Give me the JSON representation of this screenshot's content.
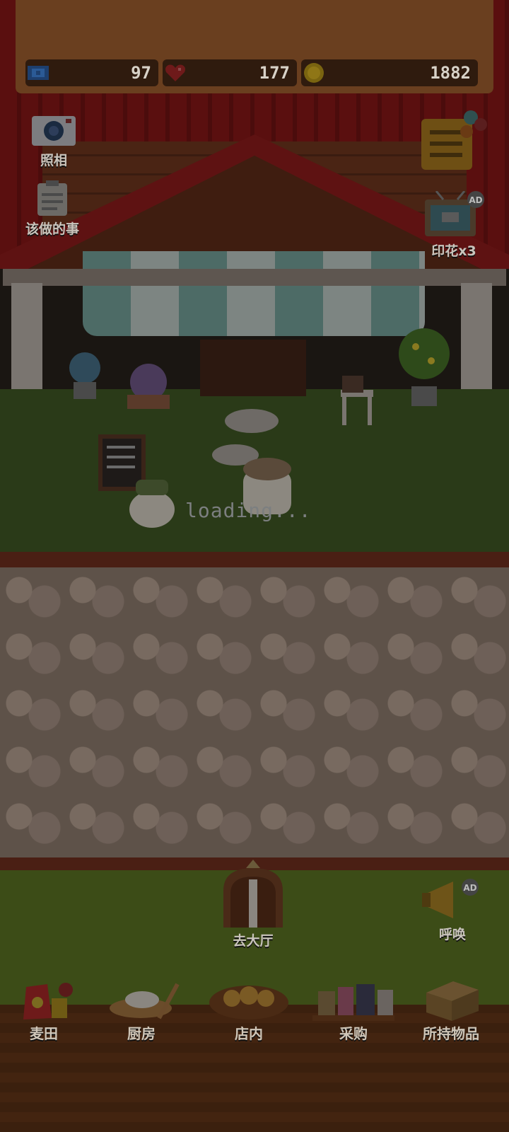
{
  "hud": {
    "tickets": "97",
    "hearts": "177",
    "coins": "1882"
  },
  "left_buttons": {
    "photo": "照相",
    "todo": "该做的事"
  },
  "right_buttons": {
    "stamp": "印花x3",
    "ad_badge": "AD"
  },
  "scene": {
    "loading_text": "loading..."
  },
  "actions": {
    "go_hall": "去大厅",
    "call": "呼唤",
    "call_ad_badge": "AD"
  },
  "nav": {
    "wheat_field": "麦田",
    "kitchen": "厨房",
    "store": "店内",
    "purchase": "采购",
    "inventory": "所持物品"
  },
  "colors": {
    "hud_bg": "#2f1b0e",
    "roof_red": "#5a0f0f",
    "lawn": "#2a3a18",
    "nav_wood": "#3b200e"
  }
}
